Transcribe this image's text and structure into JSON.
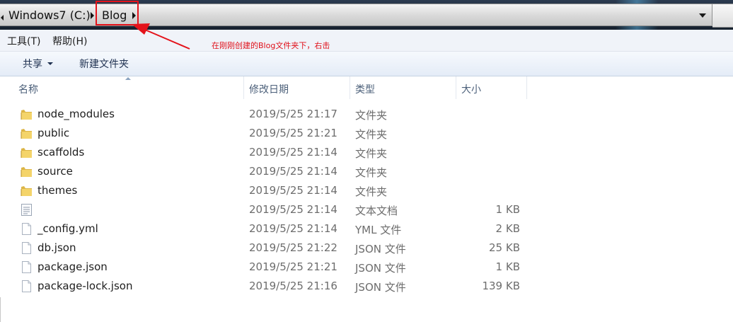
{
  "address_bar": {
    "crumbs": [
      "Windows7 (C:)",
      "Blog"
    ]
  },
  "menu": {
    "items": [
      "工具(T)",
      "帮助(H)"
    ]
  },
  "annotation": {
    "text": "在刚刚创建的Blog文件夹下，右击"
  },
  "toolbar": {
    "share_label": "共享",
    "new_folder_label": "新建文件夹"
  },
  "columns": {
    "name": "名称",
    "date": "修改日期",
    "type": "类型",
    "size": "大小"
  },
  "files": [
    {
      "name": "node_modules",
      "date": "2019/5/25 21:17",
      "type": "文件夹",
      "size": "",
      "icon": "folder-icon"
    },
    {
      "name": "public",
      "date": "2019/5/25 21:21",
      "type": "文件夹",
      "size": "",
      "icon": "folder-icon"
    },
    {
      "name": "scaffolds",
      "date": "2019/5/25 21:14",
      "type": "文件夹",
      "size": "",
      "icon": "folder-icon"
    },
    {
      "name": "source",
      "date": "2019/5/25 21:14",
      "type": "文件夹",
      "size": "",
      "icon": "folder-icon"
    },
    {
      "name": "themes",
      "date": "2019/5/25 21:14",
      "type": "文件夹",
      "size": "",
      "icon": "folder-icon"
    },
    {
      "name": "",
      "date": "2019/5/25 21:14",
      "type": "文本文档",
      "size": "1 KB",
      "icon": "text-file-icon"
    },
    {
      "name": "_config.yml",
      "date": "2019/5/25 21:14",
      "type": "YML 文件",
      "size": "2 KB",
      "icon": "file-icon"
    },
    {
      "name": "db.json",
      "date": "2019/5/25 21:22",
      "type": "JSON 文件",
      "size": "25 KB",
      "icon": "file-icon"
    },
    {
      "name": "package.json",
      "date": "2019/5/25 21:21",
      "type": "JSON 文件",
      "size": "1 KB",
      "icon": "file-icon"
    },
    {
      "name": "package-lock.json",
      "date": "2019/5/25 21:16",
      "type": "JSON 文件",
      "size": "139 KB",
      "icon": "file-icon"
    }
  ],
  "colors": {
    "annotation_red": "#e4131b",
    "folder_yellow": "#f2c94c",
    "header_text": "#4c607a"
  }
}
